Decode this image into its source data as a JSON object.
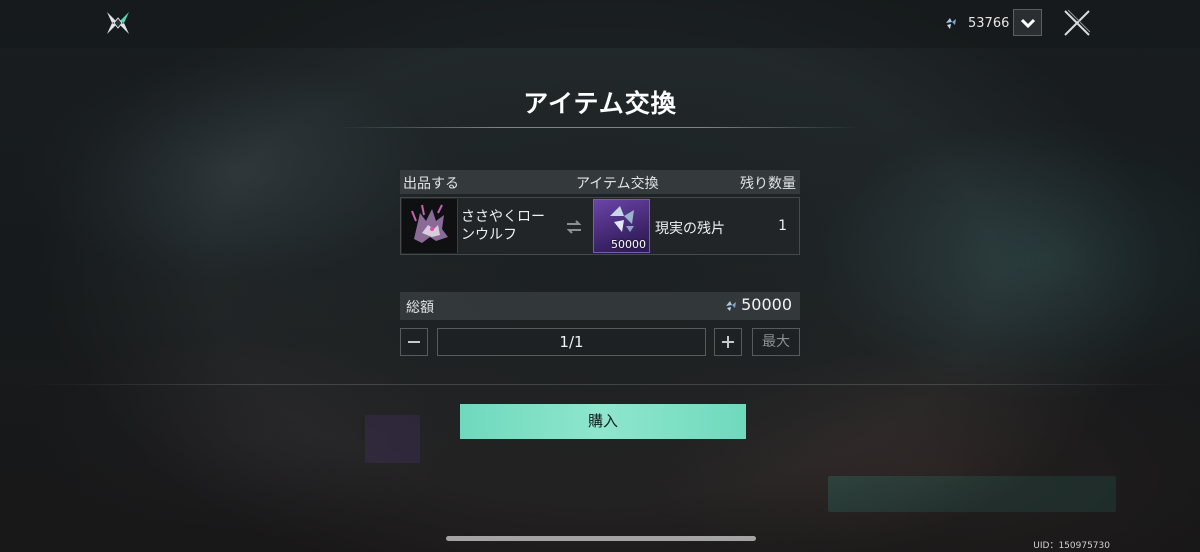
{
  "header": {
    "currency_icon": "shard-icon",
    "currency_value": "53766",
    "dropdown_icon": "chevron-down-icon",
    "close_icon": "close-icon",
    "logo_icon": "game-logo-icon"
  },
  "title": "アイテム交換",
  "table": {
    "columns": {
      "seller": "出品する",
      "exchange": "アイテム交換",
      "remaining": "残り数量"
    },
    "row": {
      "offered_item_name": "ささやくローンウルフ",
      "swap_icon": "swap-arrows-icon",
      "exchange_item_name": "現実の残片",
      "exchange_item_count": "50000",
      "remaining": "1"
    }
  },
  "total": {
    "label": "総額",
    "currency_icon": "shard-icon",
    "value": "50000"
  },
  "quantity": {
    "value": "1/1",
    "minus_icon": "minus-icon",
    "plus_icon": "plus-icon",
    "max_label": "最大"
  },
  "purchase_label": "購入",
  "uid": "UID：150975730",
  "colors": {
    "accent": "#7ddfc4",
    "exchange_tile": "#4b2f80"
  }
}
